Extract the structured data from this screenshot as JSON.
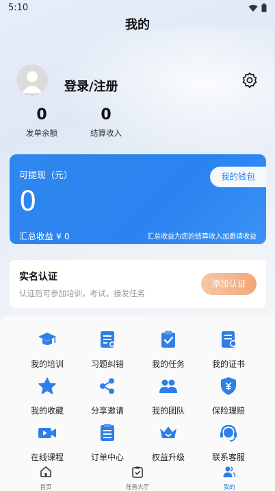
{
  "status_bar": {
    "time": "5:10"
  },
  "header": {
    "title": "我的"
  },
  "profile": {
    "login_text": "登录/注册"
  },
  "stats": [
    {
      "value": "0",
      "label": "发单余额"
    },
    {
      "value": "0",
      "label": "结算收入"
    }
  ],
  "wallet": {
    "title": "可提现（元）",
    "amount": "0",
    "button": "我的钱包",
    "total": "汇总收益 ¥ 0",
    "note": "汇总收益为您的结算收入加邀请收益"
  },
  "verify": {
    "title": "实名认证",
    "desc": "认证后可参加培训，考试，接发任务",
    "button": "添加认证"
  },
  "menu": [
    {
      "label": "我的培训",
      "icon": "graduation-cap-icon"
    },
    {
      "label": "习题纠错",
      "icon": "exercise-edit-icon"
    },
    {
      "label": "我的任务",
      "icon": "task-check-icon"
    },
    {
      "label": "我的证书",
      "icon": "certificate-icon"
    },
    {
      "label": "我的收藏",
      "icon": "star-icon"
    },
    {
      "label": "分享邀请",
      "icon": "share-icon"
    },
    {
      "label": "我的团队",
      "icon": "team-icon"
    },
    {
      "label": "保险理赔",
      "icon": "insurance-shield-icon"
    },
    {
      "label": "在线课程",
      "icon": "video-camera-icon"
    },
    {
      "label": "订单中心",
      "icon": "order-list-icon"
    },
    {
      "label": "权益升级",
      "icon": "crown-icon"
    },
    {
      "label": "联系客服",
      "icon": "headset-icon"
    }
  ],
  "tabbar": [
    {
      "label": "首页",
      "icon": "home-icon"
    },
    {
      "label": "任务大厅",
      "icon": "task-hall-icon"
    },
    {
      "label": "我的",
      "icon": "user-icon",
      "active": true
    }
  ],
  "colors": {
    "accent": "#2a83ef",
    "icon_blue": "#2f7fe8",
    "verify_button": "#f3a676"
  }
}
